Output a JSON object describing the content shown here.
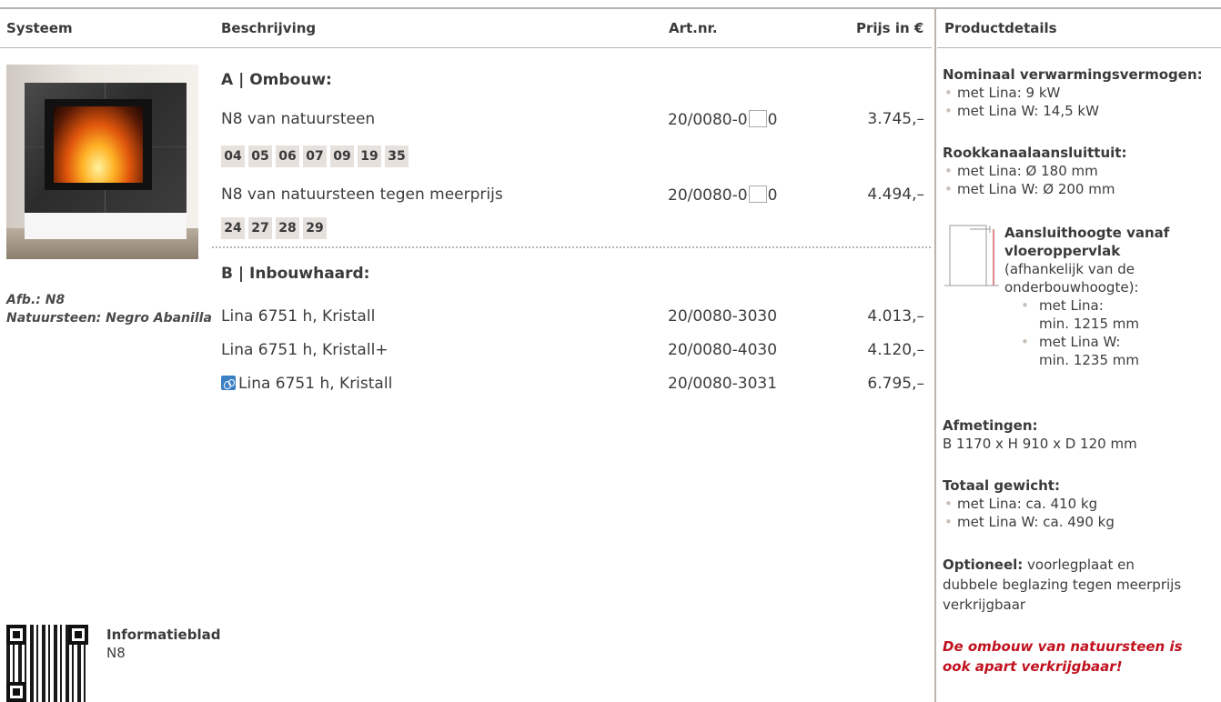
{
  "table": {
    "headers": {
      "systeem": "Systeem",
      "beschrijving": "Beschrijving",
      "artnr": "Art.nr.",
      "prijs": "Prijs in €",
      "productdetails": "Productdetails"
    }
  },
  "image": {
    "caption_line1": "Afb.: N8",
    "caption_line2": "Natuursteen: Negro Abanilla"
  },
  "section_a": {
    "title": "A | Ombouw:",
    "rows": [
      {
        "desc": "N8 van natuursteen",
        "art_prefix": "20/0080-0",
        "art_suffix": "0",
        "price": "3.745,–",
        "swatches": [
          "04",
          "05",
          "06",
          "07",
          "09",
          "19",
          "35"
        ]
      },
      {
        "desc": "N8 van natuursteen tegen meerprijs",
        "art_prefix": "20/0080-0",
        "art_suffix": "0",
        "price": "4.494,–",
        "swatches": [
          "24",
          "27",
          "28",
          "29"
        ]
      }
    ]
  },
  "section_b": {
    "title": "B | Inbouwhaard:",
    "rows": [
      {
        "desc": "Lina 6751 h, Kristall",
        "art": "20/0080-3030",
        "price": "4.013,–"
      },
      {
        "desc": "Lina 6751 h, Kristall+",
        "art": "20/0080-4030",
        "price": "4.120,–"
      },
      {
        "desc": "Lina 6751 h, Kristall",
        "art": "20/0080-3031",
        "price": "6.795,–",
        "icon": "water-icon"
      }
    ]
  },
  "info": {
    "title": "Informatieblad",
    "subtitle": "N8"
  },
  "details": {
    "vermogen_title": "Nominaal verwarmingsvermogen:",
    "vermogen": [
      "met Lina: 9 kW",
      "met Lina W: 14,5 kW"
    ],
    "rook_title": "Rookkanaalaansluittuit:",
    "rook": [
      "met Lina: Ø 180 mm",
      "met Lina W: Ø 200 mm"
    ],
    "hoogte_title_1": "Aansluithoogte vanaf",
    "hoogte_title_2": "vloeroppervlak",
    "hoogte_text_1": "(afhankelijk van de",
    "hoogte_text_2": "onderbouwhoogte):",
    "hoogte": [
      {
        "l1": "met Lina:",
        "l2": "min. 1215 mm"
      },
      {
        "l1": "met Lina W:",
        "l2": "min. 1235 mm"
      }
    ],
    "afmetingen_title": "Afmetingen:",
    "afmetingen": "B 1170 x H 910 x D 120 mm",
    "gewicht_title": "Totaal gewicht:",
    "gewicht": [
      "met Lina: ca. 410 kg",
      "met Lina W: ca. 490 kg"
    ],
    "optioneel_label": "Optioneel:",
    "optioneel_1": " voorlegplaat en",
    "optioneel_2": "dubbele beglazing tegen meerprijs",
    "optioneel_3": "verkrijgbaar",
    "note_1": "De ombouw van natuursteen is",
    "note_2": "ook apart verkrijgbaar!"
  },
  "colors": {
    "rule": "#bbb3ae",
    "swatch_bg": "#e6e1dc",
    "accent_red": "#c1121f",
    "water_icon": "#3b7fc4"
  }
}
